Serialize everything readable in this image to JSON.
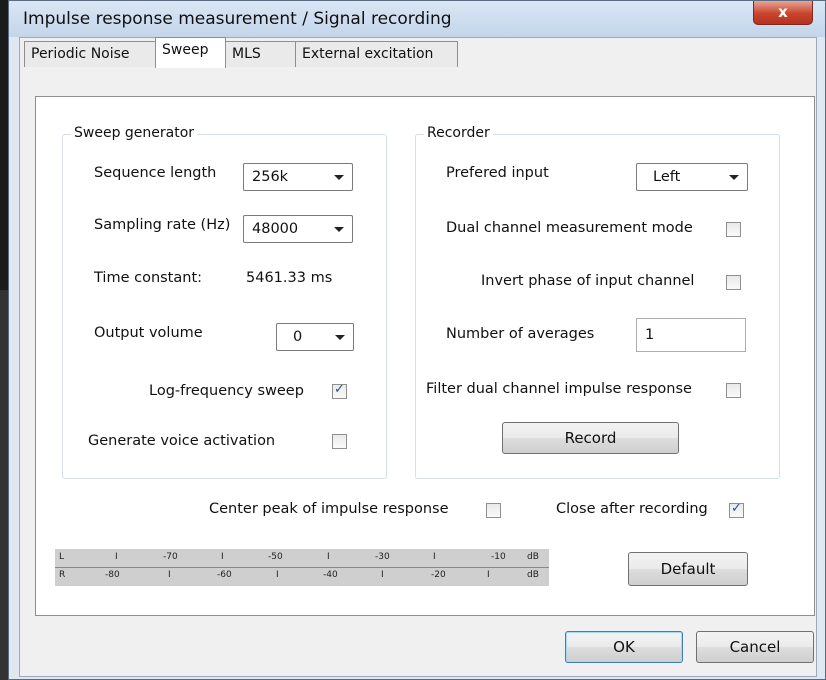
{
  "window": {
    "title": "Impulse response measurement / Signal recording",
    "close_label": "x"
  },
  "tabs": [
    {
      "label": "Periodic Noise",
      "active": false
    },
    {
      "label": "Sweep",
      "active": true
    },
    {
      "label": "MLS",
      "active": false
    },
    {
      "label": "External excitation",
      "active": false
    }
  ],
  "sweep_generator": {
    "title": "Sweep generator",
    "sequence_length_label": "Sequence length",
    "sequence_length_value": "256k",
    "sampling_rate_label": "Sampling rate (Hz)",
    "sampling_rate_value": "48000",
    "time_constant_label": "Time constant:",
    "time_constant_value": "5461.33 ms",
    "output_volume_label": "Output volume",
    "output_volume_value": "0",
    "log_sweep_label": "Log-frequency sweep",
    "log_sweep_checked": true,
    "voice_activation_label": "Generate voice activation",
    "voice_activation_checked": false
  },
  "recorder": {
    "title": "Recorder",
    "preferred_input_label": "Prefered input",
    "preferred_input_value": "Left",
    "dual_channel_label": "Dual channel measurement mode",
    "dual_channel_checked": false,
    "invert_phase_label": "Invert phase of input channel",
    "invert_phase_checked": false,
    "averages_label": "Number of averages",
    "averages_value": "1",
    "filter_dual_label": "Filter dual channel impulse response",
    "filter_dual_checked": false,
    "record_label": "Record"
  },
  "options": {
    "center_peak_label": "Center peak of impulse response",
    "center_peak_checked": false,
    "close_after_label": "Close after recording",
    "close_after_checked": true
  },
  "meter": {
    "row_l": [
      "L",
      "I",
      "-70",
      "I",
      "-50",
      "I",
      "-30",
      "I",
      "-10",
      "dB"
    ],
    "row_r": [
      "R",
      "-80",
      "I",
      "-60",
      "I",
      "-40",
      "I",
      "-20",
      "I",
      "dB"
    ]
  },
  "buttons": {
    "default_label": "Default",
    "ok_label": "OK",
    "cancel_label": "Cancel"
  }
}
